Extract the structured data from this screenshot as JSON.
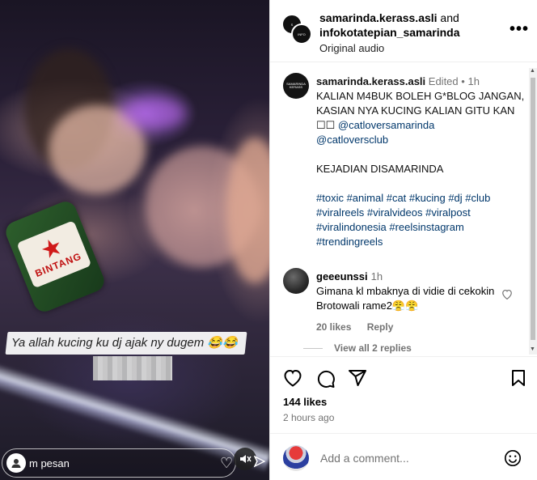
{
  "video": {
    "overlay_caption": "Ya allah kucing ku dj ajak ny dugem 😂😂",
    "bottle_label": "BINTANG",
    "reply_placeholder": "m pesan",
    "icons": {
      "mute": "mute-icon",
      "send": "send-icon",
      "heart": "heart-icon"
    }
  },
  "header": {
    "author": "samarinda.kerass.asli",
    "and_text": " and",
    "coauthor": "infokotatepian_samarinda",
    "audio": "Original audio",
    "more_icon": "more-options-icon"
  },
  "caption": {
    "username": "samarinda.kerass.asli",
    "edited": "Edited",
    "dot": "•",
    "time": "1h",
    "text_line1": "KALIAN M4BUK BOLEH G*BLOG JANGAN, KASIAN NYA KUCING KALIAN GITU KAN ☐☐ ",
    "mention1": "@catloversamarinda",
    "mention2": "@catloversclub",
    "location_line": "KEJADIAN DISAMARINDA",
    "hashtags": "#toxic #animal #cat #kucing #dj #club #viralreels #viralvideos #viralpost #viralindonesia #reelsinstagram #trendingreels"
  },
  "comment": {
    "username": "geeeunssi",
    "time": "1h",
    "text": "Gimana kl mbaknya di vidie di cekokin Brotowali rame2😤😤",
    "likes": "20 likes",
    "reply": "Reply",
    "view_replies": "View all 2 replies"
  },
  "actions": {
    "likes": "144 likes",
    "time_ago": "2 hours ago"
  },
  "comment_bar": {
    "placeholder": "Add a comment..."
  },
  "colors": {
    "link": "#00376b",
    "muted": "#737373",
    "divider": "#efefef"
  }
}
